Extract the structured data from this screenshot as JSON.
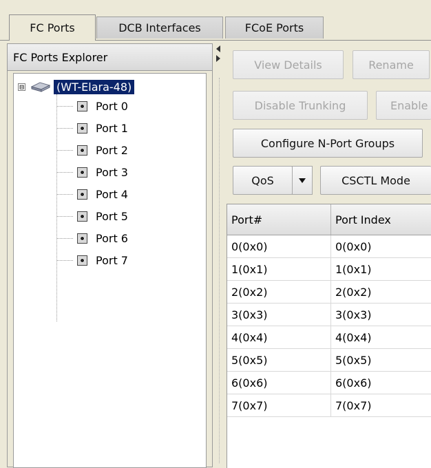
{
  "tabs": [
    {
      "label": "FC Ports",
      "active": true
    },
    {
      "label": "DCB Interfaces",
      "active": false
    },
    {
      "label": "FCoE Ports",
      "active": false
    }
  ],
  "explorer": {
    "title": "FC Ports Explorer",
    "root": {
      "label": "(WT-Elara-48)",
      "expander": "⊟",
      "icon": "switch-icon"
    },
    "ports": [
      "Port 0",
      "Port 1",
      "Port 2",
      "Port 3",
      "Port 4",
      "Port 5",
      "Port 6",
      "Port 7"
    ]
  },
  "toolbar": {
    "view_details": "View Details",
    "rename": "Rename",
    "disable_trunking": "Disable Trunking",
    "enable_partial": "Enable",
    "configure_nport_groups": "Configure N-Port Groups",
    "qos": "QoS",
    "csctl_mode": "CSCTL Mode"
  },
  "table": {
    "columns": [
      "Port#",
      "Port Index"
    ],
    "rows": [
      [
        "0(0x0)",
        "0(0x0)"
      ],
      [
        "1(0x1)",
        "1(0x1)"
      ],
      [
        "2(0x2)",
        "2(0x2)"
      ],
      [
        "3(0x3)",
        "3(0x3)"
      ],
      [
        "4(0x4)",
        "4(0x4)"
      ],
      [
        "5(0x5)",
        "5(0x5)"
      ],
      [
        "6(0x6)",
        "6(0x6)"
      ],
      [
        "7(0x7)",
        "7(0x7)"
      ]
    ]
  },
  "colors": {
    "selection": "#0a246a",
    "panel": "#ece9d8",
    "disabled_text": "#a6a6a6"
  }
}
